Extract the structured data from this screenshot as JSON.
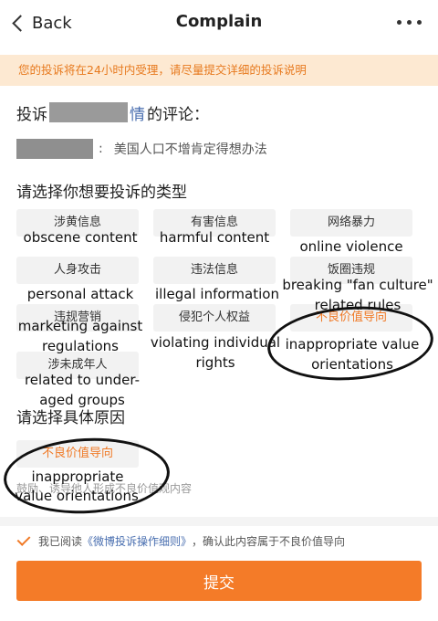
{
  "nav": {
    "back_label": "Back",
    "title": "Complain"
  },
  "notice": "您的投诉将在24小时内受理，请尽量提交详细的投诉说明",
  "target": {
    "prefix": "投诉",
    "name_tail": "情",
    "suffix": "的评论："
  },
  "comment": {
    "separator": ":",
    "text": "美国人口不增肯定得想办法"
  },
  "type_section_title": "请选择你想要投诉的类型",
  "types": [
    {
      "label": "涉黄信息",
      "translation": "obscene content"
    },
    {
      "label": "有害信息",
      "translation": "harmful content"
    },
    {
      "label": "网络暴力",
      "translation": "online violence"
    },
    {
      "label": "人身攻击",
      "translation": "personal attack"
    },
    {
      "label": "违法信息",
      "translation": "illegal information"
    },
    {
      "label": "饭圈违规",
      "translation": "breaking \"fan culture\" related rules"
    },
    {
      "label": "违规营销",
      "translation": "marketing against regulations"
    },
    {
      "label": "侵犯个人权益",
      "translation": "violating individual rights"
    },
    {
      "label": "不良价值导向",
      "translation": "inappropriate value orientations"
    },
    {
      "label": "涉未成年人",
      "translation": "related to under-aged groups"
    }
  ],
  "reason_section_title": "请选择具体原因",
  "reason": {
    "label": "不良价值导向",
    "translation_line1": "inappropriate",
    "translation_line2": "value orientations",
    "description": "鼓励、诱导他人形成不良价值观内容"
  },
  "agree": {
    "prefix": "我已阅读",
    "link": "《微博投诉操作细则》",
    "suffix": "，确认此内容属于不良价值导向"
  },
  "submit_label": "提交",
  "colors": {
    "accent": "#f47b28",
    "notice_bg": "#fde9d2",
    "link": "#4a6fb0"
  }
}
